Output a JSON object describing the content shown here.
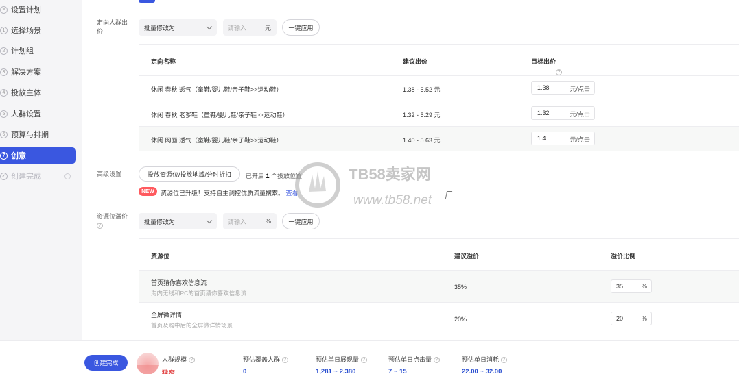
{
  "sidebar": {
    "steps": [
      {
        "num": "",
        "label": "设置计划"
      },
      {
        "num": "1",
        "label": "选择场景"
      },
      {
        "num": "2",
        "label": "计划组"
      },
      {
        "num": "3",
        "label": "解决方案"
      },
      {
        "num": "4",
        "label": "投放主体"
      },
      {
        "num": "5",
        "label": "人群设置"
      },
      {
        "num": "6",
        "label": "预算与排期"
      },
      {
        "num": "7",
        "label": "创意"
      },
      {
        "num": "",
        "label": "创建完成"
      }
    ]
  },
  "targeting": {
    "label": "定向人群出价",
    "batch_select": "批量修改为",
    "input_placeholder": "请输入",
    "input_unit": "元",
    "apply_label": "一键应用",
    "columns": [
      "定向名称",
      "建议出价",
      "目标出价"
    ],
    "rows": [
      {
        "name": "休闲 春秋 透气（童鞋/婴儿鞋/亲子鞋>>运动鞋）",
        "suggest": "1.38 - 5.52 元",
        "target": "1.38",
        "unit": "元/点击"
      },
      {
        "name": "休闲 春秋 老爹鞋（童鞋/婴儿鞋/亲子鞋>>运动鞋）",
        "suggest": "1.32 - 5.29 元",
        "target": "1.32",
        "unit": "元/点击"
      },
      {
        "name": "休闲 网面 透气（童鞋/婴儿鞋/亲子鞋>>运动鞋）",
        "suggest": "1.40 - 5.63 元",
        "target": "1.4",
        "unit": "元/点击"
      }
    ]
  },
  "advanced": {
    "label": "高级设置",
    "button": "投放资源位/投放地域/分时折扣",
    "status_prefix": "已开启",
    "status_count": "1",
    "status_suffix": "个投放位置",
    "new_badge": "NEW",
    "new_text": "资源位已升级！支持自主调控优质流量搜索。",
    "new_link": "查看"
  },
  "resource": {
    "label": "资源位溢价",
    "batch_select": "批量修改为",
    "input_placeholder": "请输入",
    "input_unit": "%",
    "apply_label": "一键应用",
    "columns": [
      "资源位",
      "建议溢价",
      "溢价比例"
    ],
    "rows": [
      {
        "name": "首页猜你喜欢信息流",
        "desc": "淘内无线和PC的首页猜你喜欢信息流",
        "suggest": "35%",
        "ratio": "35",
        "unit": "%"
      },
      {
        "name": "全屏微详情",
        "desc": "首页及购中后的全屏微详情场景",
        "suggest": "20%",
        "ratio": "20",
        "unit": "%"
      }
    ]
  },
  "watermark": {
    "title": "TB58卖家网",
    "url": "www.tb58.net"
  },
  "footer": {
    "create_label": "创建完成",
    "crowd_label": "人群规模",
    "crowd_value": "狭窄",
    "stats": [
      {
        "label": "预估覆盖人群",
        "value": "0"
      },
      {
        "label": "预估单日展现量",
        "value": "1,281 ~ 2,380"
      },
      {
        "label": "预估单日点击量",
        "value": "7 ~ 15"
      },
      {
        "label": "预估单日消耗",
        "value": "22.00 ~ 32.00"
      }
    ]
  }
}
